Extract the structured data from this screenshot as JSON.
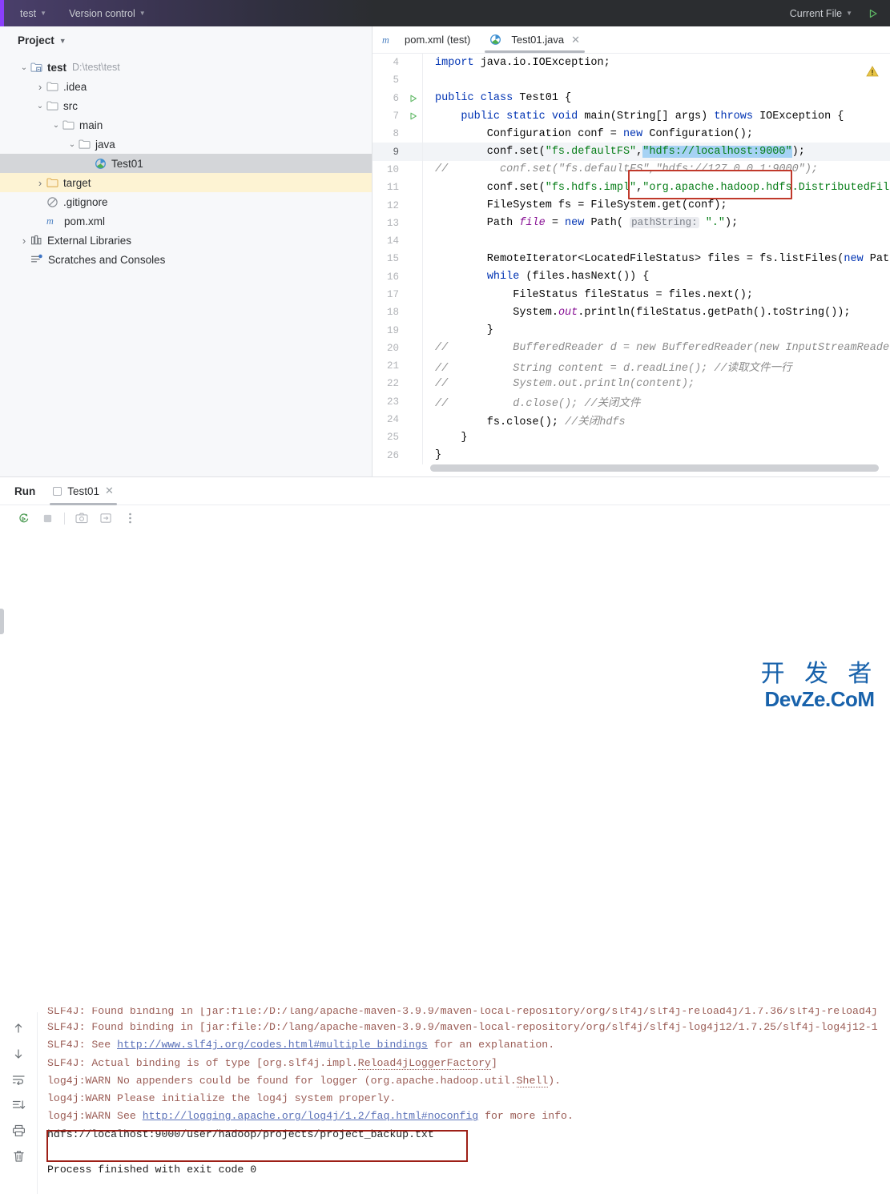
{
  "titlebar": {
    "project_name": "test",
    "version_control": "Version control",
    "run_config": "Current File",
    "run_button_icon": "run-triangle-icon"
  },
  "project_panel": {
    "title": "Project",
    "tree": [
      {
        "label": "test",
        "path": "D:\\test\\test",
        "icon": "module-icon",
        "twisty": "down",
        "indent": 0,
        "bold": true,
        "state": "normal"
      },
      {
        "label": ".idea",
        "path": "",
        "icon": "folder-icon",
        "twisty": "right",
        "indent": 1,
        "bold": false,
        "state": "normal"
      },
      {
        "label": "src",
        "path": "",
        "icon": "folder-icon",
        "twisty": "down",
        "indent": 1,
        "bold": false,
        "state": "normal"
      },
      {
        "label": "main",
        "path": "",
        "icon": "folder-icon",
        "twisty": "down",
        "indent": 2,
        "bold": false,
        "state": "normal"
      },
      {
        "label": "java",
        "path": "",
        "icon": "folder-icon",
        "twisty": "down",
        "indent": 3,
        "bold": false,
        "state": "normal"
      },
      {
        "label": "Test01",
        "path": "",
        "icon": "java-class-icon",
        "twisty": "none",
        "indent": 4,
        "bold": false,
        "state": "selected"
      },
      {
        "label": "target",
        "path": "",
        "icon": "folder-orange-icon",
        "twisty": "right",
        "indent": 1,
        "bold": false,
        "state": "highlight"
      },
      {
        "label": ".gitignore",
        "path": "",
        "icon": "gitignore-icon",
        "twisty": "none",
        "indent": 1,
        "bold": false,
        "state": "normal"
      },
      {
        "label": "pom.xml",
        "path": "",
        "icon": "maven-icon",
        "twisty": "none",
        "indent": 1,
        "bold": false,
        "state": "normal"
      },
      {
        "label": "External Libraries",
        "path": "",
        "icon": "libraries-icon",
        "twisty": "right",
        "indent": 0,
        "bold": false,
        "state": "normal"
      },
      {
        "label": "Scratches and Consoles",
        "path": "",
        "icon": "scratches-icon",
        "twisty": "none",
        "indent": 0,
        "bold": false,
        "state": "normal"
      }
    ]
  },
  "editor": {
    "tabs": [
      {
        "label": "pom.xml (test)",
        "icon": "maven-icon",
        "active": false,
        "closable": false
      },
      {
        "label": "Test01.java",
        "icon": "java-class-icon",
        "active": true,
        "closable": true
      }
    ],
    "warning_icon": "warning-triangle-icon",
    "first_line_number": 4,
    "current_line": 9,
    "lines": [
      {
        "n": 4,
        "marker": "",
        "html": "<span class=\"k\">import</span> java.io.IOException;"
      },
      {
        "n": 5,
        "marker": "",
        "html": ""
      },
      {
        "n": 6,
        "marker": "run",
        "html": "<span class=\"k\">public class</span> Test01 {"
      },
      {
        "n": 7,
        "marker": "run",
        "html": "    <span class=\"k\">public static void</span> main(String[] args) <span class=\"k\">throws</span> IOException {"
      },
      {
        "n": 8,
        "marker": "",
        "html": "        Configuration conf = <span class=\"k\">new</span> Configuration();"
      },
      {
        "n": 9,
        "marker": "",
        "html": "        conf.set(<span class=\"s\">\"fs.defaultFS\"</span>,<span class=\"s sel\">\"hdfs://localhost:9000\"</span>);"
      },
      {
        "n": 10,
        "marker": "",
        "html": "<span class=\"cm\">//        conf.set(\"fs.defaultFS\",\"hdfs://127.0.0.1:9000\");</span>"
      },
      {
        "n": 11,
        "marker": "",
        "html": "        conf.set(<span class=\"s\">\"fs.hdfs.impl\"</span>,<span class=\"s\">\"org.apache.hadoop.hdfs.DistributedFileS</span>"
      },
      {
        "n": 12,
        "marker": "",
        "html": "        FileSystem fs = FileSystem.get(conf);"
      },
      {
        "n": 13,
        "marker": "",
        "html": "        Path <span class=\"fld\">file</span> = <span class=\"k\">new</span> Path( <span class=\"hint\">pathString:</span> <span class=\"s\">\".\"</span>);"
      },
      {
        "n": 14,
        "marker": "",
        "html": ""
      },
      {
        "n": 15,
        "marker": "",
        "html": "        RemoteIterator&lt;LocatedFileStatus&gt; files = fs.listFiles(<span class=\"k\">new</span> Path("
      },
      {
        "n": 16,
        "marker": "",
        "html": "        <span class=\"k\">while</span> (files.hasNext()) {"
      },
      {
        "n": 17,
        "marker": "",
        "html": "            FileStatus fileStatus = files.next();"
      },
      {
        "n": 18,
        "marker": "",
        "html": "            System.<span class=\"fld\">out</span>.println(fileStatus.getPath().toString());"
      },
      {
        "n": 19,
        "marker": "",
        "html": "        }"
      },
      {
        "n": 20,
        "marker": "",
        "html": "<span class=\"cm\">//          BufferedReader d = new BufferedReader(new InputStreamReader(ge</span>"
      },
      {
        "n": 21,
        "marker": "",
        "html": "<span class=\"cm\">//          String content = d.readLine(); //读取文件一行</span>"
      },
      {
        "n": 22,
        "marker": "",
        "html": "<span class=\"cm\">//          System.out.println(content);</span>"
      },
      {
        "n": 23,
        "marker": "",
        "html": "<span class=\"cm\">//          d.close(); //关闭文件</span>"
      },
      {
        "n": 24,
        "marker": "",
        "html": "        fs.close(); <span class=\"cm\">//关闭hdfs</span>"
      },
      {
        "n": 25,
        "marker": "",
        "html": "    }"
      },
      {
        "n": 26,
        "marker": "",
        "html": "}"
      }
    ]
  },
  "run_panel": {
    "title": "Run",
    "tab_label": "Test01",
    "toolbar_top": [
      "rerun-icon",
      "stop-icon",
      "camera-icon",
      "export-icon",
      "more-options-icon"
    ],
    "toolbar_side": [
      "up-arrow-icon",
      "down-arrow-icon",
      "soft-wrap-icon",
      "scroll-to-end-icon",
      "print-icon",
      "trash-icon"
    ],
    "console_lines": [
      {
        "type": "clip",
        "html": "SLF4J: Found binding in [jar:file:/D:/lang/apache-maven-3.9.9/maven-local-repository/org/slf4j/slf4j-reload4j/1.7.36/slf4j-reload4j"
      },
      {
        "type": "log",
        "html": "SLF4J: Found binding in [jar:file:/D:/lang/apache-maven-3.9.9/maven-local-repository/org/slf4j/slf4j-log4j12/1.7.25/slf4j-log4j12-1"
      },
      {
        "type": "log",
        "html": "SLF4J: See <span class=\"lnk\">http://www.slf4j.org/codes.html#multiple_bindings</span> for an explanation."
      },
      {
        "type": "log",
        "html": "SLF4J: Actual binding is of type [org.slf4j.impl.<span class=\"dotted\">Reload4jLoggerFactory</span>]"
      },
      {
        "type": "log",
        "html": "log4j:WARN No appenders could be found for logger (org.apache.hadoop.util.<span class=\"dotted\">Shell</span>)."
      },
      {
        "type": "log",
        "html": "log4j:WARN Please initialize the log4j system properly."
      },
      {
        "type": "log",
        "html": "log4j:WARN See <span class=\"lnk\">http://logging.apache.org/log4j/1.2/faq.html#noconfig</span> for more info."
      },
      {
        "type": "out",
        "html": "<span class=\"cout\">hdfs://localhost:9000/user/hadoop/projects/project_backup.txt</span>"
      },
      {
        "type": "blank",
        "html": ""
      },
      {
        "type": "finish",
        "html": "<span class=\"cfinish\">Process finished with exit code 0</span>"
      }
    ]
  },
  "watermark": {
    "line1": "开 发 者",
    "line2": "DevZe.CoM"
  },
  "colors": {
    "titlebar_bg": "#2b2d30",
    "accent_purple": "#8a3ffc",
    "run_green": "#5fb865",
    "selection_blue": "#a6d2f4",
    "redbox": "#c0392b",
    "console_red": "#9b5d56",
    "tree_highlight": "#fdf3d3"
  }
}
